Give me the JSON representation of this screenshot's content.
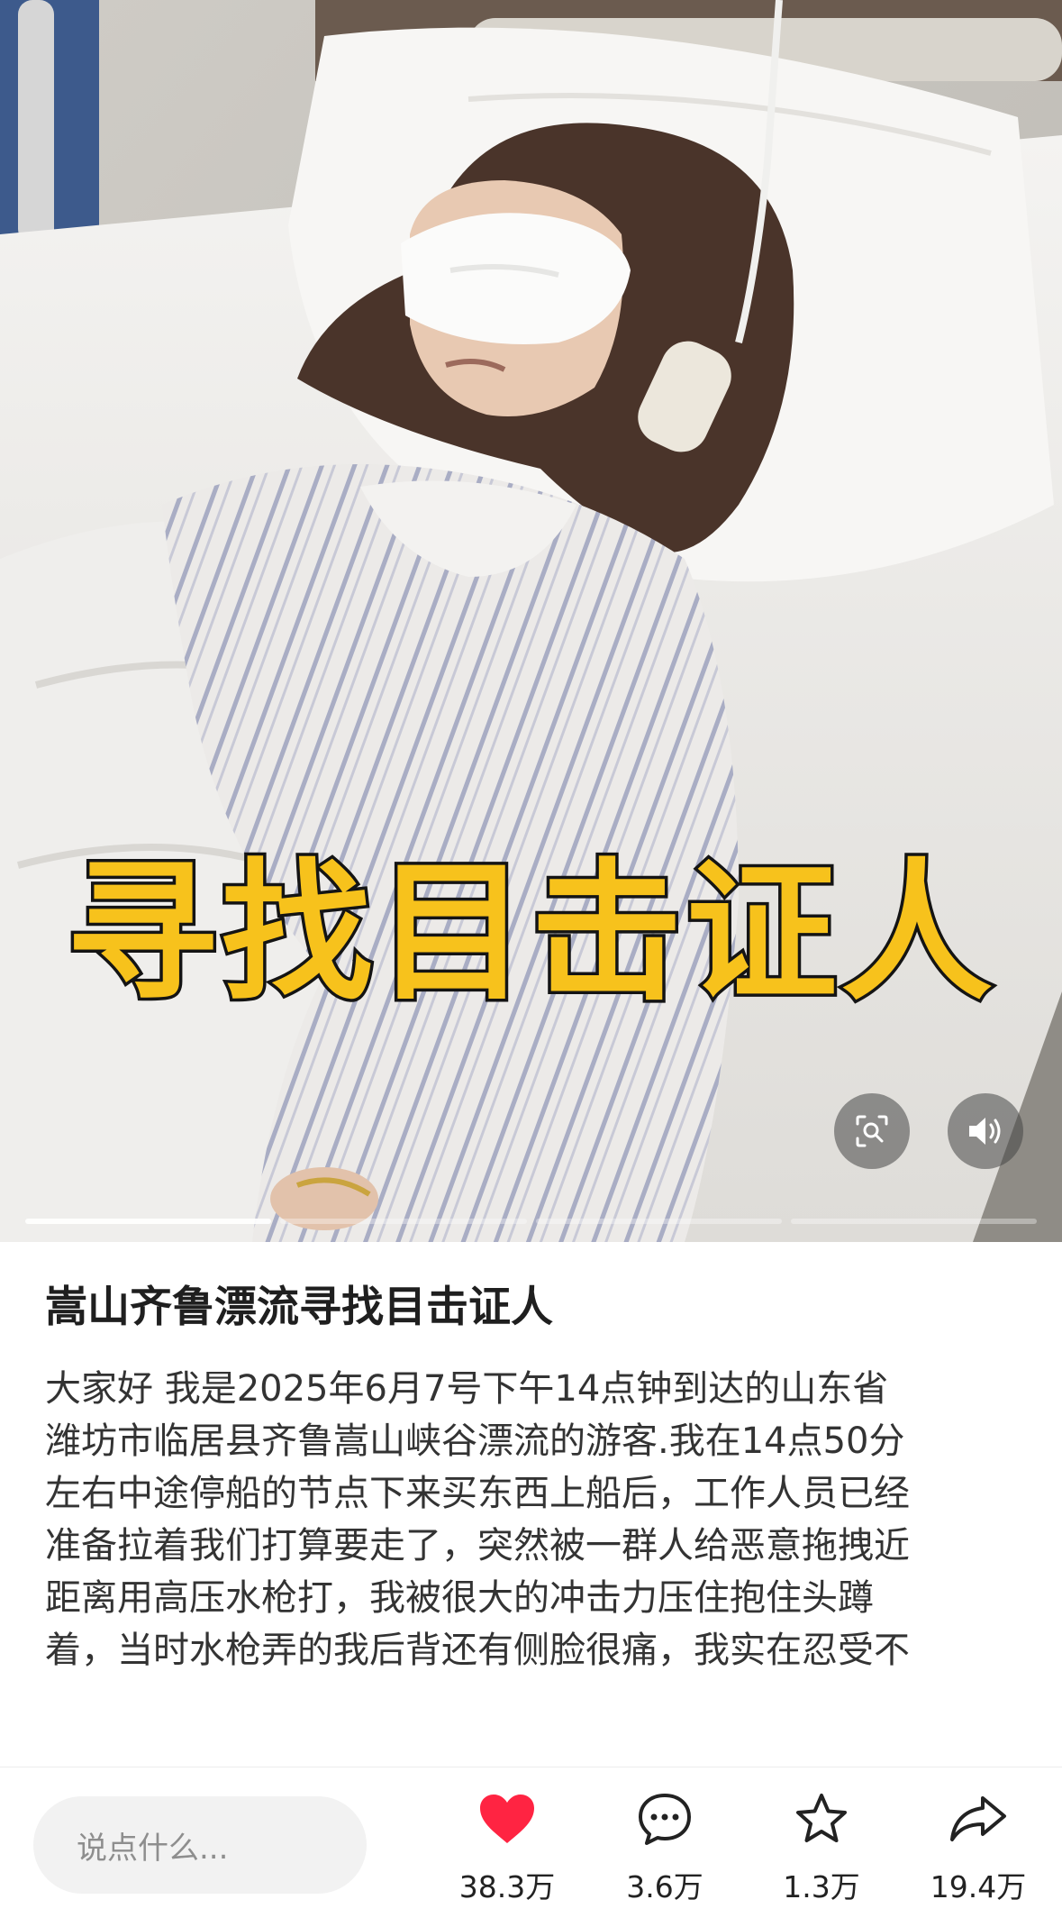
{
  "media": {
    "overlay_text": "寻找目击证人",
    "search_icon": "visual-search-icon",
    "sound_icon": "speaker-icon",
    "slides": 4,
    "current_slide": 1
  },
  "post": {
    "title": "嵩山齐鲁漂流寻找目击证人",
    "body_lines": [
      "大家好 我是2025年6月7号下午14点钟到达的山东省",
      "潍坊市临居县齐鲁嵩山峡谷漂流的游客.我在14点50分",
      "左右中途停船的节点下来买东西上船后，工作人员已经",
      "准备拉着我们打算要走了，突然被一群人给恶意拖拽近",
      "距离用高压水枪打，我被很大的冲击力压住抱住头蹲",
      "着，当时水枪弄的我后背还有侧脸很痛，我实在忍受不"
    ]
  },
  "bottom_bar": {
    "comment_placeholder": "说点什么...",
    "like_count": "38.3万",
    "comment_count": "3.6万",
    "favorite_count": "1.3万",
    "share_count": "19.4万",
    "like_color": "#ff2442",
    "icons": {
      "like": "heart-icon",
      "comment": "chat-bubble-icon",
      "favorite": "star-icon",
      "share": "share-arrow-icon"
    }
  }
}
